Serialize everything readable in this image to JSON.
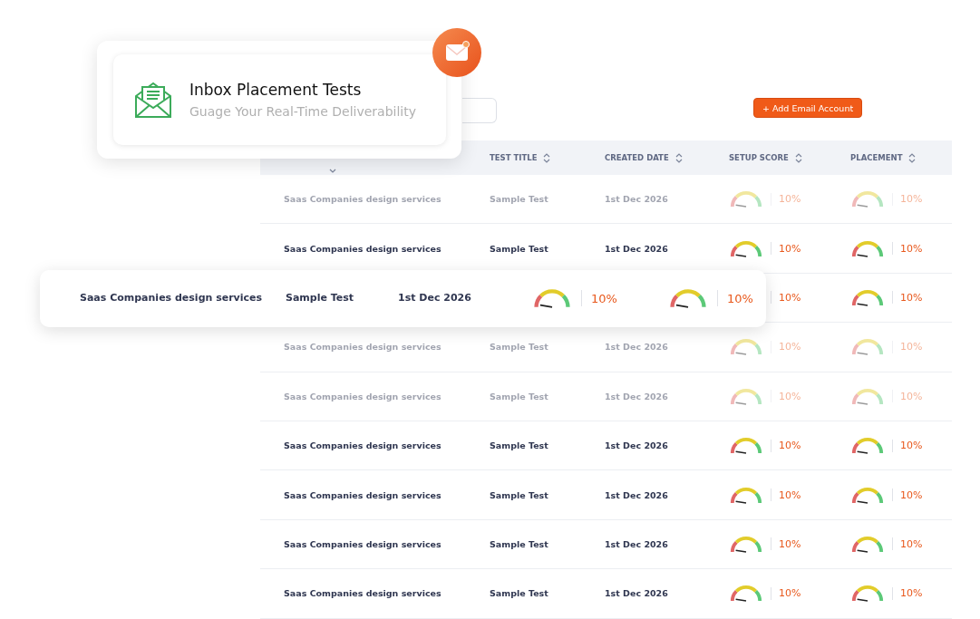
{
  "feature_card": {
    "title": "Inbox Placement Tests",
    "subtitle": "Guage Your Real-Time Deliverability"
  },
  "toolbar": {
    "add_button": "+ Add Email Account"
  },
  "table": {
    "columns": [
      {
        "label": "TEST TITLE"
      },
      {
        "label": "CREATED DATE"
      },
      {
        "label": "SETUP SCORE"
      },
      {
        "label": "PLACEMENT"
      }
    ],
    "rows": [
      {
        "faded": true,
        "subject": "Saas Companies design services",
        "test_title": "Sample Test",
        "created": "1st Dec 2026",
        "setup": "10%",
        "placement": "10%"
      },
      {
        "faded": false,
        "subject": "Saas Companies design services",
        "test_title": "Sample Test",
        "created": "1st Dec 2026",
        "setup": "10%",
        "placement": "10%"
      },
      {
        "faded": false,
        "setup": "10%",
        "placement": "10%"
      },
      {
        "faded": true,
        "subject": "Saas Companies design services",
        "test_title": "Sample Test",
        "created": "1st Dec 2026",
        "setup": "10%",
        "placement": "10%"
      },
      {
        "faded": true,
        "subject": "Saas Companies design services",
        "test_title": "Sample Test",
        "created": "1st Dec 2026",
        "setup": "10%",
        "placement": "10%"
      },
      {
        "faded": false,
        "subject": "Saas Companies design services",
        "test_title": "Sample Test",
        "created": "1st Dec 2026",
        "setup": "10%",
        "placement": "10%"
      },
      {
        "faded": false,
        "subject": "Saas Companies design services",
        "test_title": "Sample Test",
        "created": "1st Dec 2026",
        "setup": "10%",
        "placement": "10%"
      },
      {
        "faded": false,
        "subject": "Saas Companies design services",
        "test_title": "Sample Test",
        "created": "1st Dec 2026",
        "setup": "10%",
        "placement": "10%"
      },
      {
        "faded": false,
        "subject": "Saas Companies design services",
        "test_title": "Sample Test",
        "created": "1st Dec 2026",
        "setup": "10%",
        "placement": "10%"
      }
    ]
  },
  "floating_row": {
    "subject": "Saas Companies design services",
    "test_title": "Sample Test",
    "created": "1st Dec 2026",
    "setup": "10%",
    "placement": "10%"
  }
}
